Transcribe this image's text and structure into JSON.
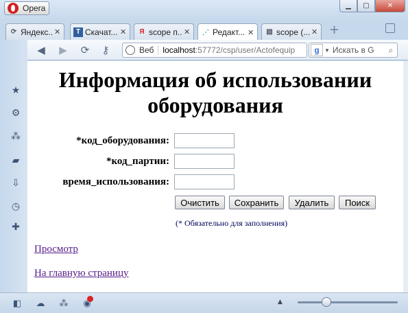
{
  "app": {
    "name": "Opera"
  },
  "tabs": [
    {
      "label": "Яндекс...",
      "favicon": "yandex-icon"
    },
    {
      "label": "Скачат...",
      "favicon": "t-icon"
    },
    {
      "label": "scope п...",
      "favicon": "yandex-y-icon"
    },
    {
      "label": "Редакт...",
      "favicon": "chart-icon",
      "active": true
    },
    {
      "label": "scope (...",
      "favicon": "page-icon"
    }
  ],
  "addressbar": {
    "web_label": "Веб",
    "host": "localhost",
    "path": ":57772/csp/user/Actofequip",
    "search_placeholder": "Искать в G"
  },
  "form": {
    "title": "Информация об использовании оборудования",
    "fields": [
      {
        "label": "*код_оборудования:",
        "value": ""
      },
      {
        "label": "*код_партии:",
        "value": ""
      },
      {
        "label": "время_использования:",
        "value": ""
      }
    ],
    "buttons": {
      "clear": "Очистить",
      "save": "Сохранить",
      "delete": "Удалить",
      "search": "Поиск"
    },
    "note": "(* Обязательно для заполнения)"
  },
  "links": {
    "view": "Просмотр",
    "home": "На главную страницу"
  },
  "colors": {
    "link": "#551a8b",
    "note": "#00005a",
    "chrome": "#c6d8ec"
  }
}
